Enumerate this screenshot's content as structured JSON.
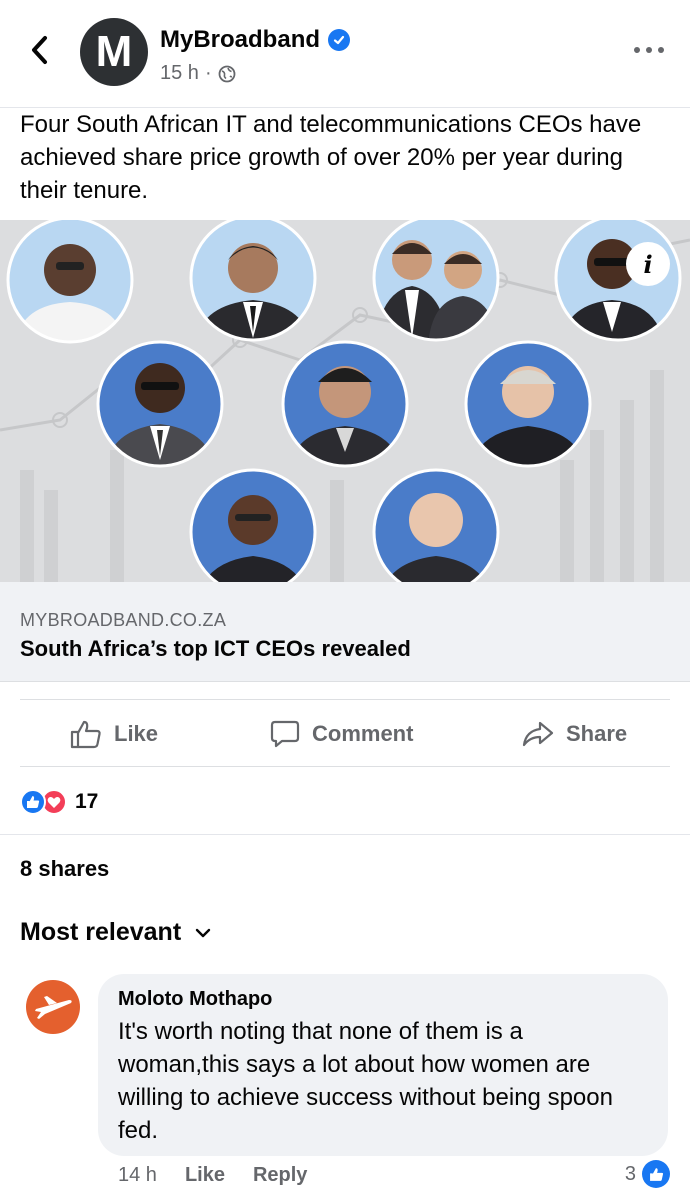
{
  "header": {
    "page_name": "MyBroadband",
    "avatar_letter": "M",
    "time": "15 h",
    "separator": "·"
  },
  "post": {
    "text": "Four South African IT and telecommunications CEOs have achieved share price growth of over 20% per year during their tenure."
  },
  "link": {
    "domain": "MYBROADBAND.CO.ZA",
    "title": "South Africa’s top ICT CEOs revealed",
    "info_glyph": "i"
  },
  "actions": {
    "like": "Like",
    "comment": "Comment",
    "share": "Share"
  },
  "stats": {
    "reaction_count": "17",
    "shares": "8 shares"
  },
  "comments_section": {
    "sort_label": "Most relevant"
  },
  "comment": {
    "author": "Moloto Mothapo",
    "text": "It's worth noting that none of them is a woman,this says a lot about how women are willing to achieve success without being spoon fed.",
    "time": "14 h",
    "like_label": "Like",
    "reply_label": "Reply",
    "like_count": "3"
  },
  "colors": {
    "brand_blue": "#1877f2",
    "love_red": "#f33e58",
    "secondary_text": "#65676b",
    "avatar_dark": "#2d3033",
    "commenter_orange": "#e4602e",
    "portrait_light_blue": "#b9d7f2",
    "portrait_mid_blue": "#4a7cc9"
  }
}
